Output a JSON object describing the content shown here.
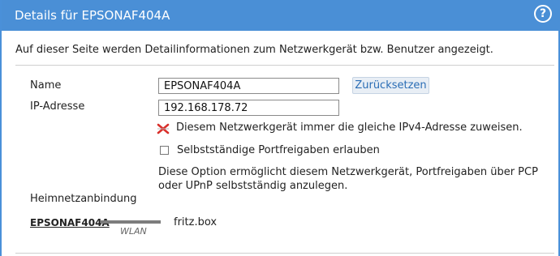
{
  "header": {
    "title": "Details für EPSONAF404A",
    "help_label": "?"
  },
  "description": "Auf dieser Seite werden Detailinformationen zum Netzwerkgerät bzw. Benutzer angezeigt.",
  "form": {
    "name_label": "Name",
    "name_value": "EPSONAF404A",
    "ip_label": "IP-Adresse",
    "ip_value": "192.168.178.72",
    "reset_label": "Zurücksetzen"
  },
  "options": {
    "same_ip": {
      "label": "Diesem Netzwerkgerät immer die gleiche IPv4-Adresse zuweisen.",
      "icon": "cross-icon"
    },
    "portfreigaben": {
      "label": "Selbstständige Portfreigaben erlauben",
      "checked": false
    },
    "info_text": "Diese Option ermöglicht diesem Netzwerkgerät, Portfreigaben über PCP oder UPnP selbstständig anzulegen."
  },
  "heimnetz": {
    "label": "Heimnetzanbindung",
    "device": "EPSONAF404A",
    "connection": "WLAN",
    "router": "fritz.box"
  },
  "colors": {
    "accent": "#4a8fd6",
    "cross": "#d9302b"
  }
}
